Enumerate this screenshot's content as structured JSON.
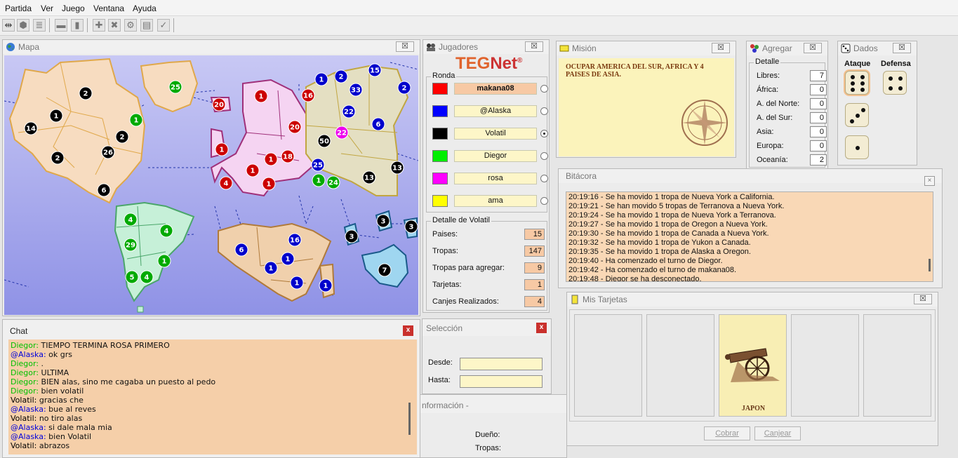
{
  "menu": [
    "Partida",
    "Ver",
    "Juego",
    "Ventana",
    "Ayuda"
  ],
  "windows": {
    "mapa": "Mapa",
    "jugadores": "Jugadores",
    "mision": "Misión",
    "agregar": "Agregar",
    "dados": "Dados",
    "bitacora": "Bitácora",
    "tarjetas": "Mis Tarjetas",
    "chat": "Chat",
    "seleccion": "Selección",
    "informacion": "nformación -"
  },
  "close_label": "x",
  "logo": {
    "teg": "TEG",
    "net": "Net",
    "reg": "®"
  },
  "jugadores": {
    "ronda_label": "Ronda",
    "players": [
      {
        "name": "makana08",
        "color": "#ff0000",
        "highlight": true,
        "selected": false
      },
      {
        "name": "@Alaska",
        "color": "#0000ff",
        "highlight": false,
        "selected": false
      },
      {
        "name": "Volatil",
        "color": "#000000",
        "highlight": false,
        "selected": true
      },
      {
        "name": "Diegor",
        "color": "#00ee00",
        "highlight": false,
        "selected": false
      },
      {
        "name": "rosa",
        "color": "#ff00ff",
        "highlight": false,
        "selected": false
      },
      {
        "name": "ama",
        "color": "#ffff00",
        "highlight": false,
        "selected": false
      }
    ],
    "detalle_title": "Detalle de Volatil",
    "detalle": [
      {
        "label": "Paises:",
        "value": "15"
      },
      {
        "label": "Tropas:",
        "value": "147"
      },
      {
        "label": "Tropas para agregar:",
        "value": "9"
      },
      {
        "label": "Tarjetas:",
        "value": "1"
      },
      {
        "label": "Canjes Realizados:",
        "value": "4"
      }
    ]
  },
  "mision": {
    "text": "OCUPAR AMERICA DEL SUR, AFRICA Y 4 PAISES DE ASIA."
  },
  "agregar": {
    "group": "Detalle",
    "rows": [
      {
        "label": "Libres:",
        "value": "7"
      },
      {
        "label": "África:",
        "value": "0"
      },
      {
        "label": "A. del Norte:",
        "value": "0"
      },
      {
        "label": "A. del Sur:",
        "value": "0"
      },
      {
        "label": "Asia:",
        "value": "0"
      },
      {
        "label": "Europa:",
        "value": "0"
      },
      {
        "label": "Oceanía:",
        "value": "2"
      }
    ]
  },
  "dados": {
    "ataque": "Ataque",
    "defensa": "Defensa",
    "attack": [
      6,
      3,
      1
    ],
    "defense": [
      4
    ]
  },
  "bitacora": [
    "20:19:16 - Se ha movido 1 tropa de Nueva York a California.",
    "20:19:21 - Se han movido 5 tropas de Terranova a Nueva York.",
    "20:19:24 - Se ha movido 1 tropa de Nueva York a Terranova.",
    "20:19:27 - Se ha movido 1 tropa de Oregon a Nueva York.",
    "20:19:30 - Se ha movido 1 tropa de Canada a Nueva York.",
    "20:19:32 - Se ha movido 1 tropa de Yukon a Canada.",
    "20:19:35 - Se ha movido 1 tropa de Alaska a Oregon.",
    "20:19:40 - Ha comenzado el turno de Diegor.",
    "20:19:42 - Ha comenzado el turno de makana08.",
    "20:19:48 - Diegor se ha desconectado."
  ],
  "tarjetas": {
    "card_name": "JAPON",
    "cobrar": "Cobrar",
    "canjear": "Canjear"
  },
  "chat": [
    {
      "user": "Diegor",
      "msg": "TIEMPO TERMINA ROSA PRIMERO",
      "color": "#00c000"
    },
    {
      "user": "@Alaska",
      "msg": "ok grs",
      "color": "#0000dd"
    },
    {
      "user": "Diegor",
      "msg": ".",
      "color": "#00c000"
    },
    {
      "user": "Diegor",
      "msg": "ULTIMA",
      "color": "#00c000"
    },
    {
      "user": "Diegor",
      "msg": "BIEN alas, sino me cagaba un puesto al pedo",
      "color": "#00c000"
    },
    {
      "user": "Diegor",
      "msg": "bien volatil",
      "color": "#00c000"
    },
    {
      "user": "Volatil",
      "msg": "gracias che",
      "color": "#000000"
    },
    {
      "user": "@Alaska",
      "msg": "bue  al reves",
      "color": "#0000dd"
    },
    {
      "user": "Volatil",
      "msg": "no tiro alas",
      "color": "#000000"
    },
    {
      "user": "@Alaska",
      "msg": "si dale mala mia",
      "color": "#0000dd"
    },
    {
      "user": "@Alaska",
      "msg": "bien Volatil",
      "color": "#0000dd"
    },
    {
      "user": "Volatil",
      "msg": "abrazos",
      "color": "#000000"
    }
  ],
  "seleccion": {
    "desde": "Desde:",
    "hasta": "Hasta:"
  },
  "informacion": {
    "dueno": "Dueño:",
    "tropas": "Tropas:"
  },
  "armies": [
    {
      "n": "2",
      "c": "#000"
    },
    {
      "n": "1",
      "c": "#000"
    },
    {
      "n": "14",
      "c": "#000"
    },
    {
      "n": "2",
      "c": "#000"
    },
    {
      "n": "26",
      "c": "#000"
    },
    {
      "n": "2",
      "c": "#000"
    },
    {
      "n": "6",
      "c": "#000"
    },
    {
      "n": "2",
      "c": "#000"
    },
    {
      "n": "1",
      "c": "#0a0"
    },
    {
      "n": "25",
      "c": "#0a0"
    },
    {
      "n": "20",
      "c": "#c00"
    },
    {
      "n": "1",
      "c": "#c00"
    },
    {
      "n": "1",
      "c": "#c00"
    },
    {
      "n": "20",
      "c": "#c00"
    },
    {
      "n": "1",
      "c": "#c00"
    },
    {
      "n": "18",
      "c": "#c00"
    },
    {
      "n": "1",
      "c": "#c00"
    },
    {
      "n": "4",
      "c": "#c00"
    },
    {
      "n": "1",
      "c": "#c00"
    },
    {
      "n": "16",
      "c": "#c00"
    },
    {
      "n": "1",
      "c": "#00c"
    },
    {
      "n": "2",
      "c": "#00c"
    },
    {
      "n": "33",
      "c": "#00c"
    },
    {
      "n": "15",
      "c": "#00c"
    },
    {
      "n": "2",
      "c": "#00c"
    },
    {
      "n": "22",
      "c": "#00c"
    },
    {
      "n": "6",
      "c": "#00c"
    },
    {
      "n": "22",
      "c": "#e0e"
    },
    {
      "n": "50",
      "c": "#000"
    },
    {
      "n": "25",
      "c": "#00c"
    },
    {
      "n": "1",
      "c": "#0a0"
    },
    {
      "n": "24",
      "c": "#0a0"
    },
    {
      "n": "13",
      "c": "#000"
    },
    {
      "n": "13",
      "c": "#000"
    },
    {
      "n": "4",
      "c": "#0a0"
    },
    {
      "n": "4",
      "c": "#0a0"
    },
    {
      "n": "29",
      "c": "#0a0"
    },
    {
      "n": "1",
      "c": "#0a0"
    },
    {
      "n": "5",
      "c": "#0a0"
    },
    {
      "n": "4",
      "c": "#0a0"
    },
    {
      "n": "6",
      "c": "#00c"
    },
    {
      "n": "16",
      "c": "#00c"
    },
    {
      "n": "1",
      "c": "#00c"
    },
    {
      "n": "1",
      "c": "#00c"
    },
    {
      "n": "1",
      "c": "#00c"
    },
    {
      "n": "1",
      "c": "#00c"
    },
    {
      "n": "3",
      "c": "#000"
    },
    {
      "n": "3",
      "c": "#000"
    },
    {
      "n": "3",
      "c": "#000"
    },
    {
      "n": "7",
      "c": "#000"
    }
  ]
}
